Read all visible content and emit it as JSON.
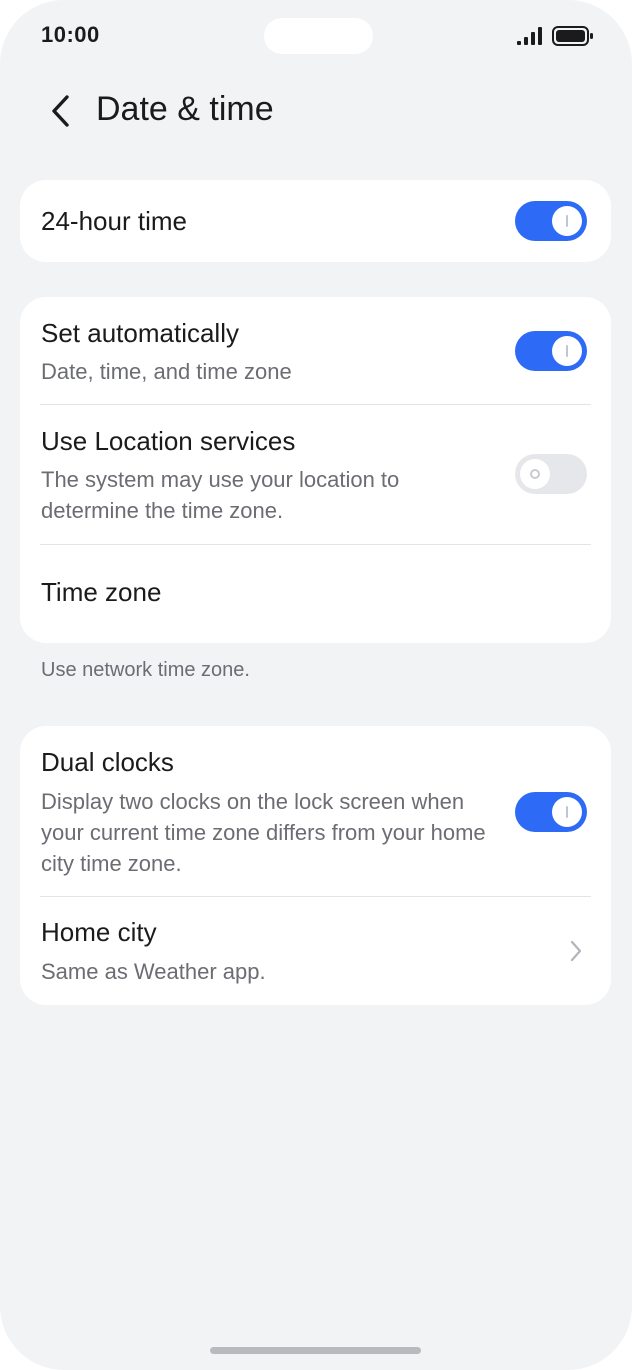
{
  "status_bar": {
    "time": "10:00"
  },
  "header": {
    "title": "Date & time"
  },
  "settings": {
    "hour24": {
      "title": "24-hour time",
      "enabled": true
    },
    "set_automatically": {
      "title": "Set automatically",
      "subtitle": "Date, time, and time zone",
      "enabled": true
    },
    "use_location": {
      "title": "Use Location services",
      "subtitle": "The system may use your location to determine the time zone.",
      "enabled": false
    },
    "time_zone": {
      "title": "Time zone"
    },
    "time_zone_note": "Use network time zone.",
    "dual_clocks": {
      "title": "Dual clocks",
      "subtitle": "Display two clocks on the lock screen when your current time zone differs from your home city time zone.",
      "enabled": true
    },
    "home_city": {
      "title": "Home city",
      "subtitle": "Same as Weather app."
    }
  },
  "colors": {
    "accent": "#2d6af6",
    "background": "#f2f3f5",
    "card": "#ffffff",
    "toggle_off": "#e6e7ea"
  }
}
